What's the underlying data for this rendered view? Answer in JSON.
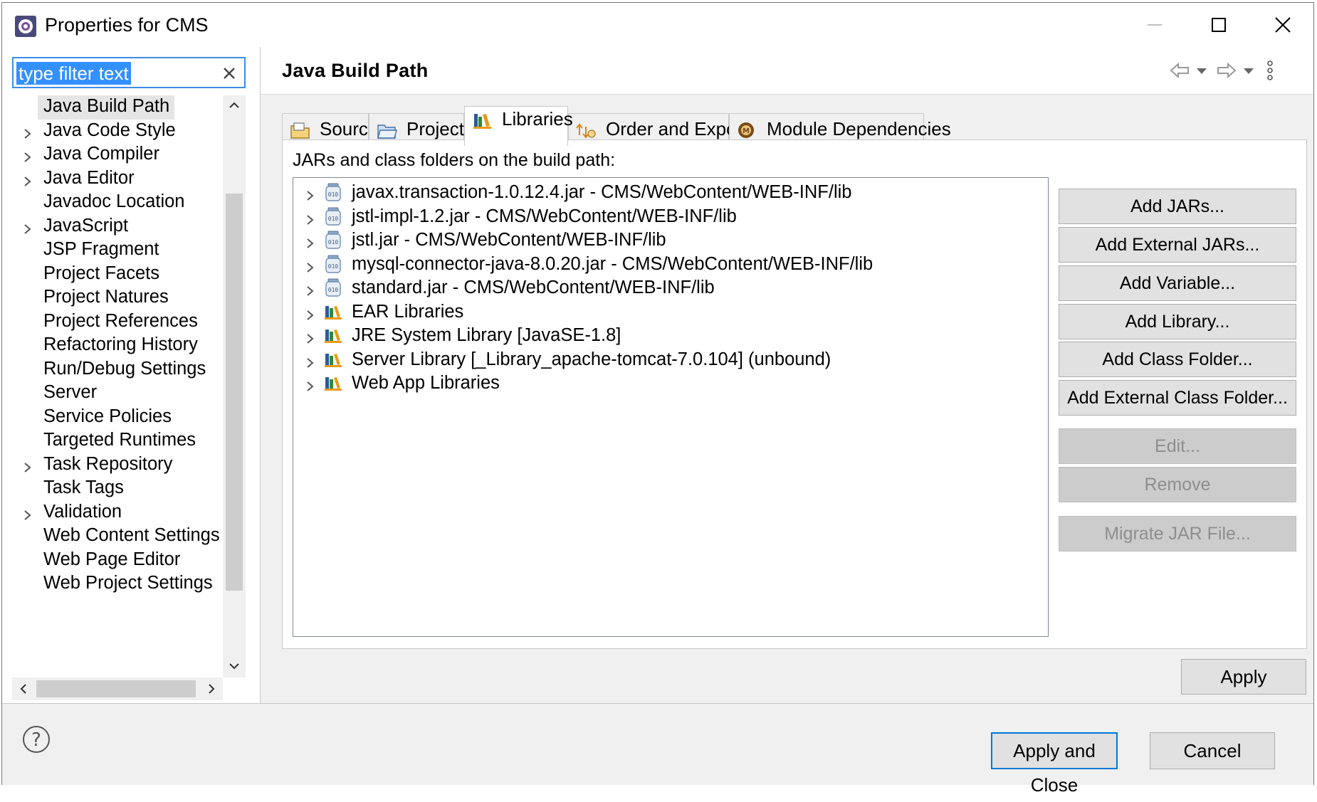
{
  "window": {
    "title": "Properties for CMS",
    "icons": {
      "app": "gear-window-icon",
      "minimize": "minimize-icon",
      "maximize": "maximize-icon",
      "close": "close-icon"
    }
  },
  "filter": {
    "value": "type filter text",
    "clear_icon": "clear-x-icon"
  },
  "tree": {
    "items": [
      {
        "label": "Java Build Path",
        "expandable": false,
        "selected": true
      },
      {
        "label": "Java Code Style",
        "expandable": true
      },
      {
        "label": "Java Compiler",
        "expandable": true
      },
      {
        "label": "Java Editor",
        "expandable": true
      },
      {
        "label": "Javadoc Location",
        "expandable": false
      },
      {
        "label": "JavaScript",
        "expandable": true
      },
      {
        "label": "JSP Fragment",
        "expandable": false
      },
      {
        "label": "Project Facets",
        "expandable": false
      },
      {
        "label": "Project Natures",
        "expandable": false
      },
      {
        "label": "Project References",
        "expandable": false
      },
      {
        "label": "Refactoring History",
        "expandable": false
      },
      {
        "label": "Run/Debug Settings",
        "expandable": false
      },
      {
        "label": "Server",
        "expandable": false
      },
      {
        "label": "Service Policies",
        "expandable": false
      },
      {
        "label": "Targeted Runtimes",
        "expandable": false
      },
      {
        "label": "Task Repository",
        "expandable": true
      },
      {
        "label": "Task Tags",
        "expandable": false
      },
      {
        "label": "Validation",
        "expandable": true
      },
      {
        "label": "Web Content Settings",
        "expandable": false
      },
      {
        "label": "Web Page Editor",
        "expandable": false
      },
      {
        "label": "Web Project Settings",
        "expandable": false
      }
    ]
  },
  "page": {
    "title": "Java Build Path",
    "nav_icons": [
      "back-arrow-icon",
      "back-menu-icon",
      "forward-arrow-icon",
      "forward-menu-icon",
      "view-menu-icon"
    ]
  },
  "tabs": [
    {
      "label": "Source",
      "icon": "source-folder-icon",
      "active": false
    },
    {
      "label": "Projects",
      "icon": "projects-folder-icon",
      "active": false
    },
    {
      "label": "Libraries",
      "icon": "libraries-icon",
      "active": true
    },
    {
      "label": "Order and Export",
      "icon": "order-export-icon",
      "active": false
    },
    {
      "label": "Module Dependencies",
      "icon": "module-dependencies-icon",
      "active": false
    }
  ],
  "libraries": {
    "caption": "JARs and class folders on the build path:",
    "entries": [
      {
        "label": "javax.transaction-1.0.12.4.jar - CMS/WebContent/WEB-INF/lib",
        "icon": "jar-icon"
      },
      {
        "label": "jstl-impl-1.2.jar - CMS/WebContent/WEB-INF/lib",
        "icon": "jar-icon"
      },
      {
        "label": "jstl.jar - CMS/WebContent/WEB-INF/lib",
        "icon": "jar-icon"
      },
      {
        "label": "mysql-connector-java-8.0.20.jar - CMS/WebContent/WEB-INF/lib",
        "icon": "jar-icon"
      },
      {
        "label": "standard.jar - CMS/WebContent/WEB-INF/lib",
        "icon": "jar-icon"
      },
      {
        "label": "EAR Libraries",
        "icon": "library-icon"
      },
      {
        "label": "JRE System Library [JavaSE-1.8]",
        "icon": "library-icon"
      },
      {
        "label": "Server Library [_Library_apache-tomcat-7.0.104] (unbound)",
        "icon": "library-icon"
      },
      {
        "label": "Web App Libraries",
        "icon": "library-icon"
      }
    ]
  },
  "buttons": {
    "add_jars": "Add JARs...",
    "add_external_jars": "Add External JARs...",
    "add_variable": "Add Variable...",
    "add_library": "Add Library...",
    "add_class_folder": "Add Class Folder...",
    "add_external_class_folder": "Add External Class Folder...",
    "edit": "Edit...",
    "remove": "Remove",
    "migrate_jar": "Migrate JAR File...",
    "apply": "Apply",
    "apply_and_close": "Apply and Close",
    "cancel": "Cancel"
  },
  "colors": {
    "selection": "#3390ff",
    "focus_border": "#0078d7",
    "library_icon": "#e89a1b",
    "jar_icon": "#6e8fb5"
  }
}
